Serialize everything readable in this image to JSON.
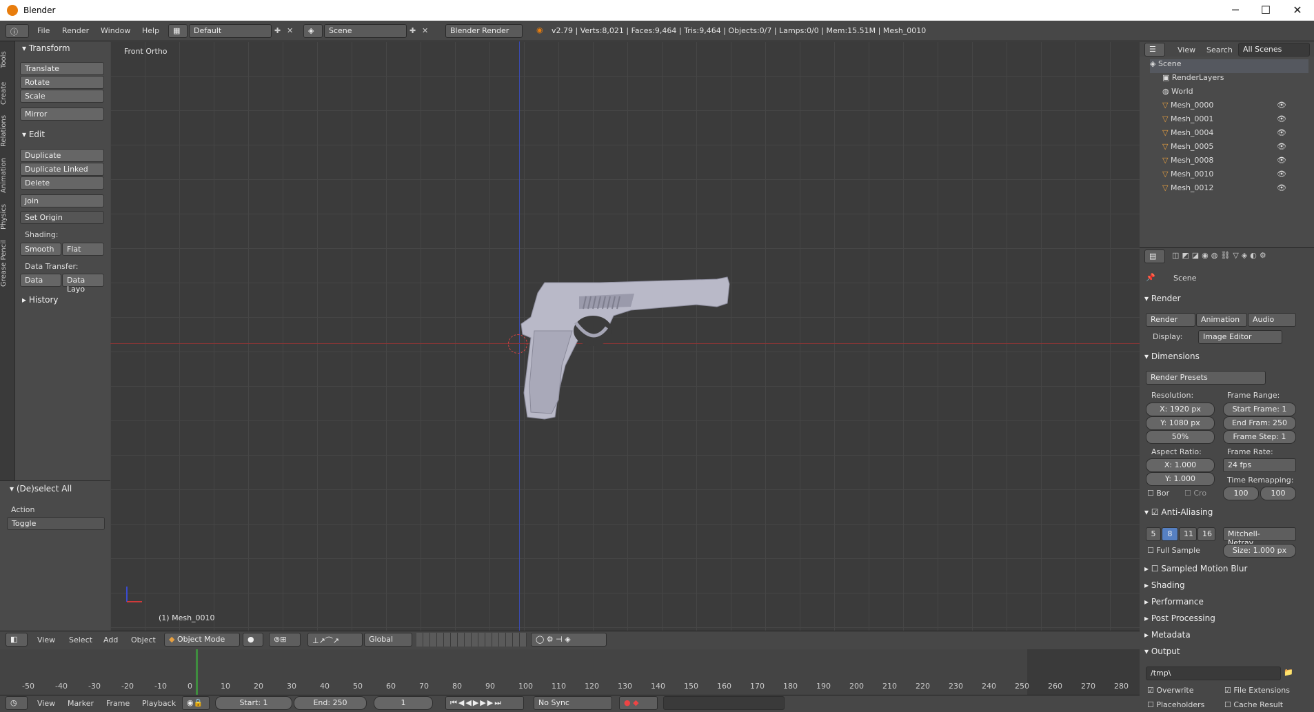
{
  "window": {
    "title": "Blender",
    "min": "─",
    "max": "☐",
    "close": "✕"
  },
  "topbar": {
    "menus": [
      "File",
      "Render",
      "Window",
      "Help"
    ],
    "layout": "Default",
    "scene": "Scene",
    "engine": "Blender Render",
    "stats": "v2.79 | Verts:8,021 | Faces:9,464 | Tris:9,464 | Objects:0/7 | Lamps:0/0 | Mem:15.51M | Mesh_0010"
  },
  "vtabs": [
    "Tools",
    "Create",
    "Relations",
    "Animation",
    "Physics",
    "Grease Pencil"
  ],
  "tools": {
    "transform": "Transform",
    "translate": "Translate",
    "rotate": "Rotate",
    "scale": "Scale",
    "mirror": "Mirror",
    "edit": "Edit",
    "duplicate": "Duplicate",
    "duplicate_linked": "Duplicate Linked",
    "delete": "Delete",
    "join": "Join",
    "set_origin": "Set Origin",
    "shading": "Shading:",
    "smooth": "Smooth",
    "flat": "Flat",
    "data_transfer": "Data Transfer:",
    "data": "Data",
    "data_layo": "Data Layo",
    "history": "History",
    "deselect": "(De)select All",
    "action": "Action",
    "toggle": "Toggle"
  },
  "viewport": {
    "label": "Front Ortho",
    "object": "(1) Mesh_0010"
  },
  "outliner": {
    "view": "View",
    "search": "Search",
    "allscenes": "All Scenes",
    "scene": "Scene",
    "renderlayers": "RenderLayers",
    "world": "World",
    "meshes": [
      "Mesh_0000",
      "Mesh_0001",
      "Mesh_0004",
      "Mesh_0005",
      "Mesh_0008",
      "Mesh_0010",
      "Mesh_0012"
    ]
  },
  "props": {
    "scene": "Scene",
    "render": "Render",
    "render_btn": "Render",
    "animation_btn": "Animation",
    "audio_btn": "Audio",
    "display": "Display:",
    "display_val": "Image Editor",
    "dimensions": "Dimensions",
    "presets": "Render Presets",
    "resolution": "Resolution:",
    "frame_range": "Frame Range:",
    "res_x": "X:",
    "res_x_val": "1920 px",
    "res_y": "Y:",
    "res_y_val": "1080 px",
    "res_pct": "50%",
    "start_frame": "Start Frame: 1",
    "end_frame": "End Fram: 250",
    "frame_step": "Frame Step: 1",
    "aspect": "Aspect Ratio:",
    "frame_rate": "Frame Rate:",
    "asp_x": "X:",
    "asp_x_val": "1.000",
    "asp_y": "Y:",
    "asp_y_val": "1.000",
    "fps": "24 fps",
    "time_remap": "Time Remapping:",
    "remap_a": "100",
    "remap_b": "100",
    "bor": "Bor",
    "cro": "Cro",
    "aa": "Anti-Aliasing",
    "aa5": "5",
    "aa8": "8",
    "aa11": "11",
    "aa16": "16",
    "filter": "Mitchell-Netrav...",
    "full_sample": "Full Sample",
    "size": "Size: 1.000 px",
    "motion_blur": "Sampled Motion Blur",
    "shading": "Shading",
    "performance": "Performance",
    "post": "Post Processing",
    "metadata": "Metadata",
    "output": "Output",
    "path": "/tmp\\",
    "overwrite": "Overwrite",
    "file_ext": "File Extensions",
    "placeholders": "Placeholders",
    "cache": "Cache Result"
  },
  "vpheader": {
    "view": "View",
    "select": "Select",
    "add": "Add",
    "object": "Object",
    "mode": "Object Mode",
    "orient": "Global"
  },
  "timeline": {
    "ticks": [
      "-50",
      "-40",
      "-30",
      "-20",
      "-10",
      "0",
      "10",
      "20",
      "30",
      "40",
      "50",
      "60",
      "70",
      "80",
      "90",
      "100",
      "110",
      "120",
      "130",
      "140",
      "150",
      "160",
      "170",
      "180",
      "190",
      "200",
      "210",
      "220",
      "230",
      "240",
      "250",
      "260",
      "270",
      "280"
    ]
  },
  "tlheader": {
    "view": "View",
    "marker": "Marker",
    "frame": "Frame",
    "playback": "Playback",
    "start": "Start:",
    "start_val": "1",
    "end": "End:",
    "end_val": "250",
    "cur": "1",
    "sync": "No Sync"
  }
}
